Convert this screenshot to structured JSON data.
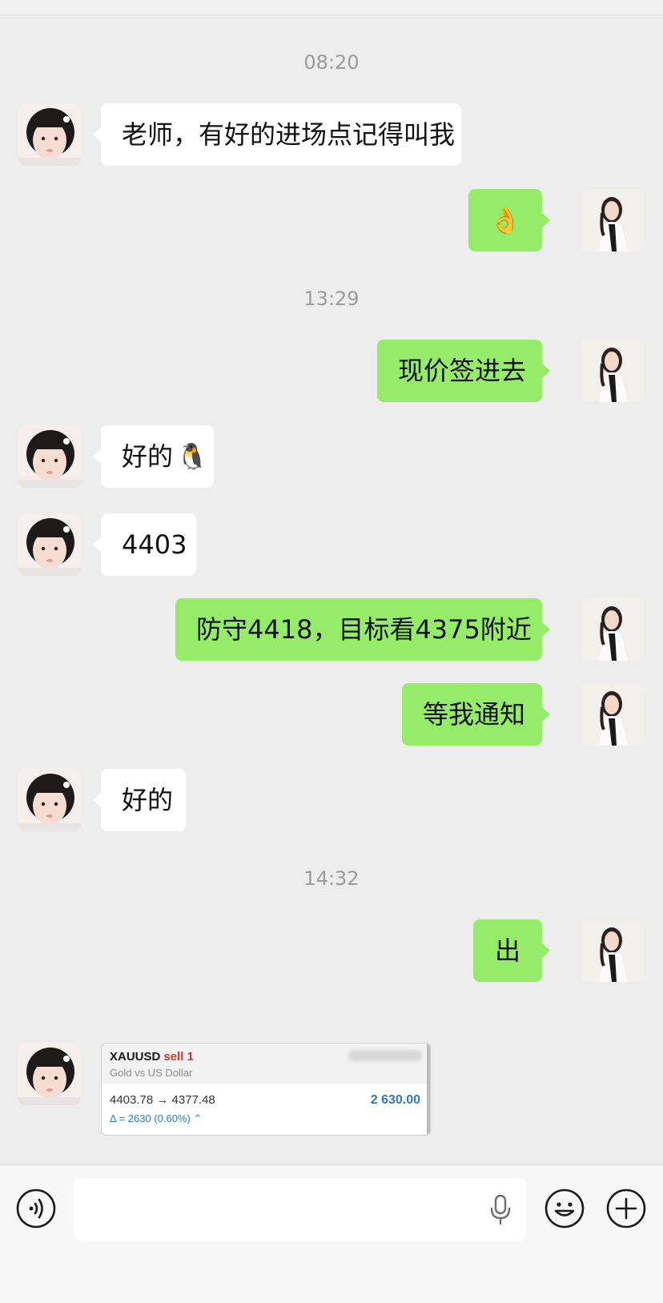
{
  "timestamps": [
    "08:20",
    "13:29",
    "14:32"
  ],
  "messages": {
    "m1": "老师，有好的进场点记得叫我",
    "m2": "👌",
    "m3": "现价签进去",
    "m4": "好的",
    "m4_emoji": "🐧",
    "m5": "4403",
    "m6": "防守4418，目标看4375附近",
    "m7": "等我通知",
    "m8": "好的",
    "m9": "出"
  },
  "trade_card": {
    "symbol": "XAUUSD",
    "side": "sell 1",
    "description": "Gold vs US Dollar",
    "prices": "4403.78 → 4377.48",
    "profit": "2 630.00",
    "delta": "Δ = 2630 (0.60%) ⌃"
  },
  "icons": {
    "voice": "voice-toggle-icon",
    "mic": "microphone-icon",
    "emoji": "emoji-icon",
    "more": "plus-icon"
  },
  "colors": {
    "outgoing_bubble": "#95ec69",
    "incoming_bubble": "#ffffff",
    "background": "#ededed",
    "profit_blue": "#2f78c8",
    "sell_red": "#d9342b"
  }
}
